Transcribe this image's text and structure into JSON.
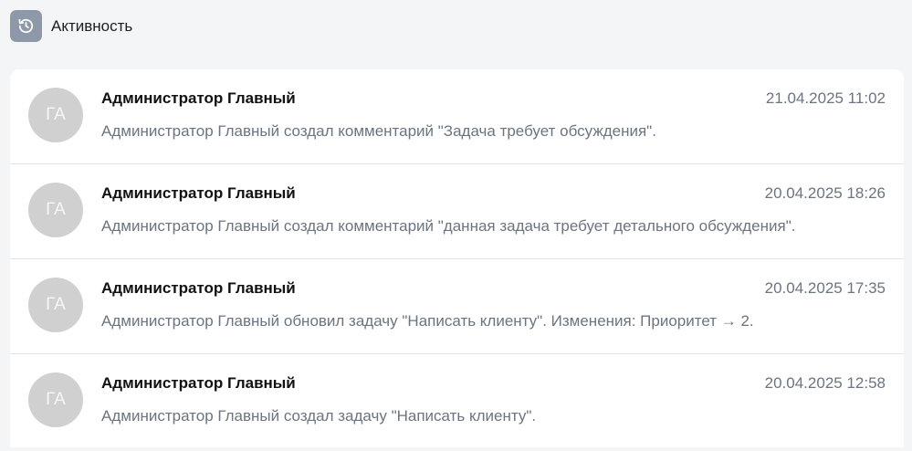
{
  "header": {
    "icon": "history-icon",
    "title": "Активность"
  },
  "activity": [
    {
      "initials": "ГА",
      "author": "Администратор Главный",
      "time": "21.04.2025 11:02",
      "text": "Администратор Главный создал комментарий \"Задача требует обсуждения\"."
    },
    {
      "initials": "ГА",
      "author": "Администратор Главный",
      "time": "20.04.2025 18:26",
      "text": "Администратор Главный создал комментарий \"данная задача требует детального обсуждения\"."
    },
    {
      "initials": "ГА",
      "author": "Администратор Главный",
      "time": "20.04.2025 17:35",
      "text": "Администратор Главный обновил задачу \"Написать клиенту\". Изменения: Приоритет → 2."
    },
    {
      "initials": "ГА",
      "author": "Администратор Главный",
      "time": "20.04.2025 12:58",
      "text": "Администратор Главный создал задачу \"Написать клиенту\"."
    }
  ]
}
